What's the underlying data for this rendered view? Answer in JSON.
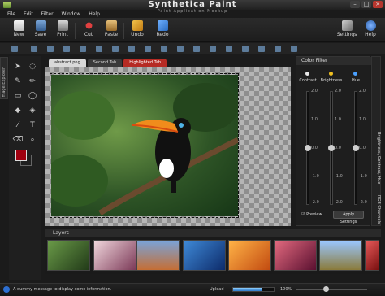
{
  "window": {
    "title": "Synthetica Paint",
    "subtitle": "Paint Application Mockup"
  },
  "menu": [
    "File",
    "Edit",
    "Filter",
    "Window",
    "Help"
  ],
  "toolbar": {
    "new": "New",
    "save": "Save",
    "print": "Print",
    "cut": "Cut",
    "paste": "Paste",
    "undo": "Undo",
    "redo": "Redo",
    "settings": "Settings",
    "help": "Help"
  },
  "sidebar": {
    "explorer_label": "Image Explorer"
  },
  "tabs": [
    "abstract.png",
    "Second Tab",
    "Highlighted Tab"
  ],
  "color_filter": {
    "title": "Color Filter",
    "sliders": [
      {
        "label": "Contrast",
        "value": 0.0,
        "color": "#e8e8e8"
      },
      {
        "label": "Brightness",
        "value": 0.0,
        "color": "#f0c020"
      },
      {
        "label": "Hue",
        "value": 0.0,
        "color": "#4aa0ff"
      }
    ],
    "ticks": [
      "2.0",
      "1.0",
      "0.0",
      "-1.0",
      "-2.0"
    ],
    "preview_label": "Preview",
    "apply_label": "Apply Settings"
  },
  "side_panels": {
    "top": "Brightness, Contrast, Hue",
    "bottom": "RGB Channels"
  },
  "layers": {
    "title": "Layers"
  },
  "status": {
    "message": "A dummy message to display some information.",
    "upload_label": "Upload",
    "upload_progress": 0.7,
    "zoom": "100%"
  },
  "colors": {
    "foreground": "#a00010",
    "background": "#202020",
    "highlight_tab": "#b62b24"
  }
}
